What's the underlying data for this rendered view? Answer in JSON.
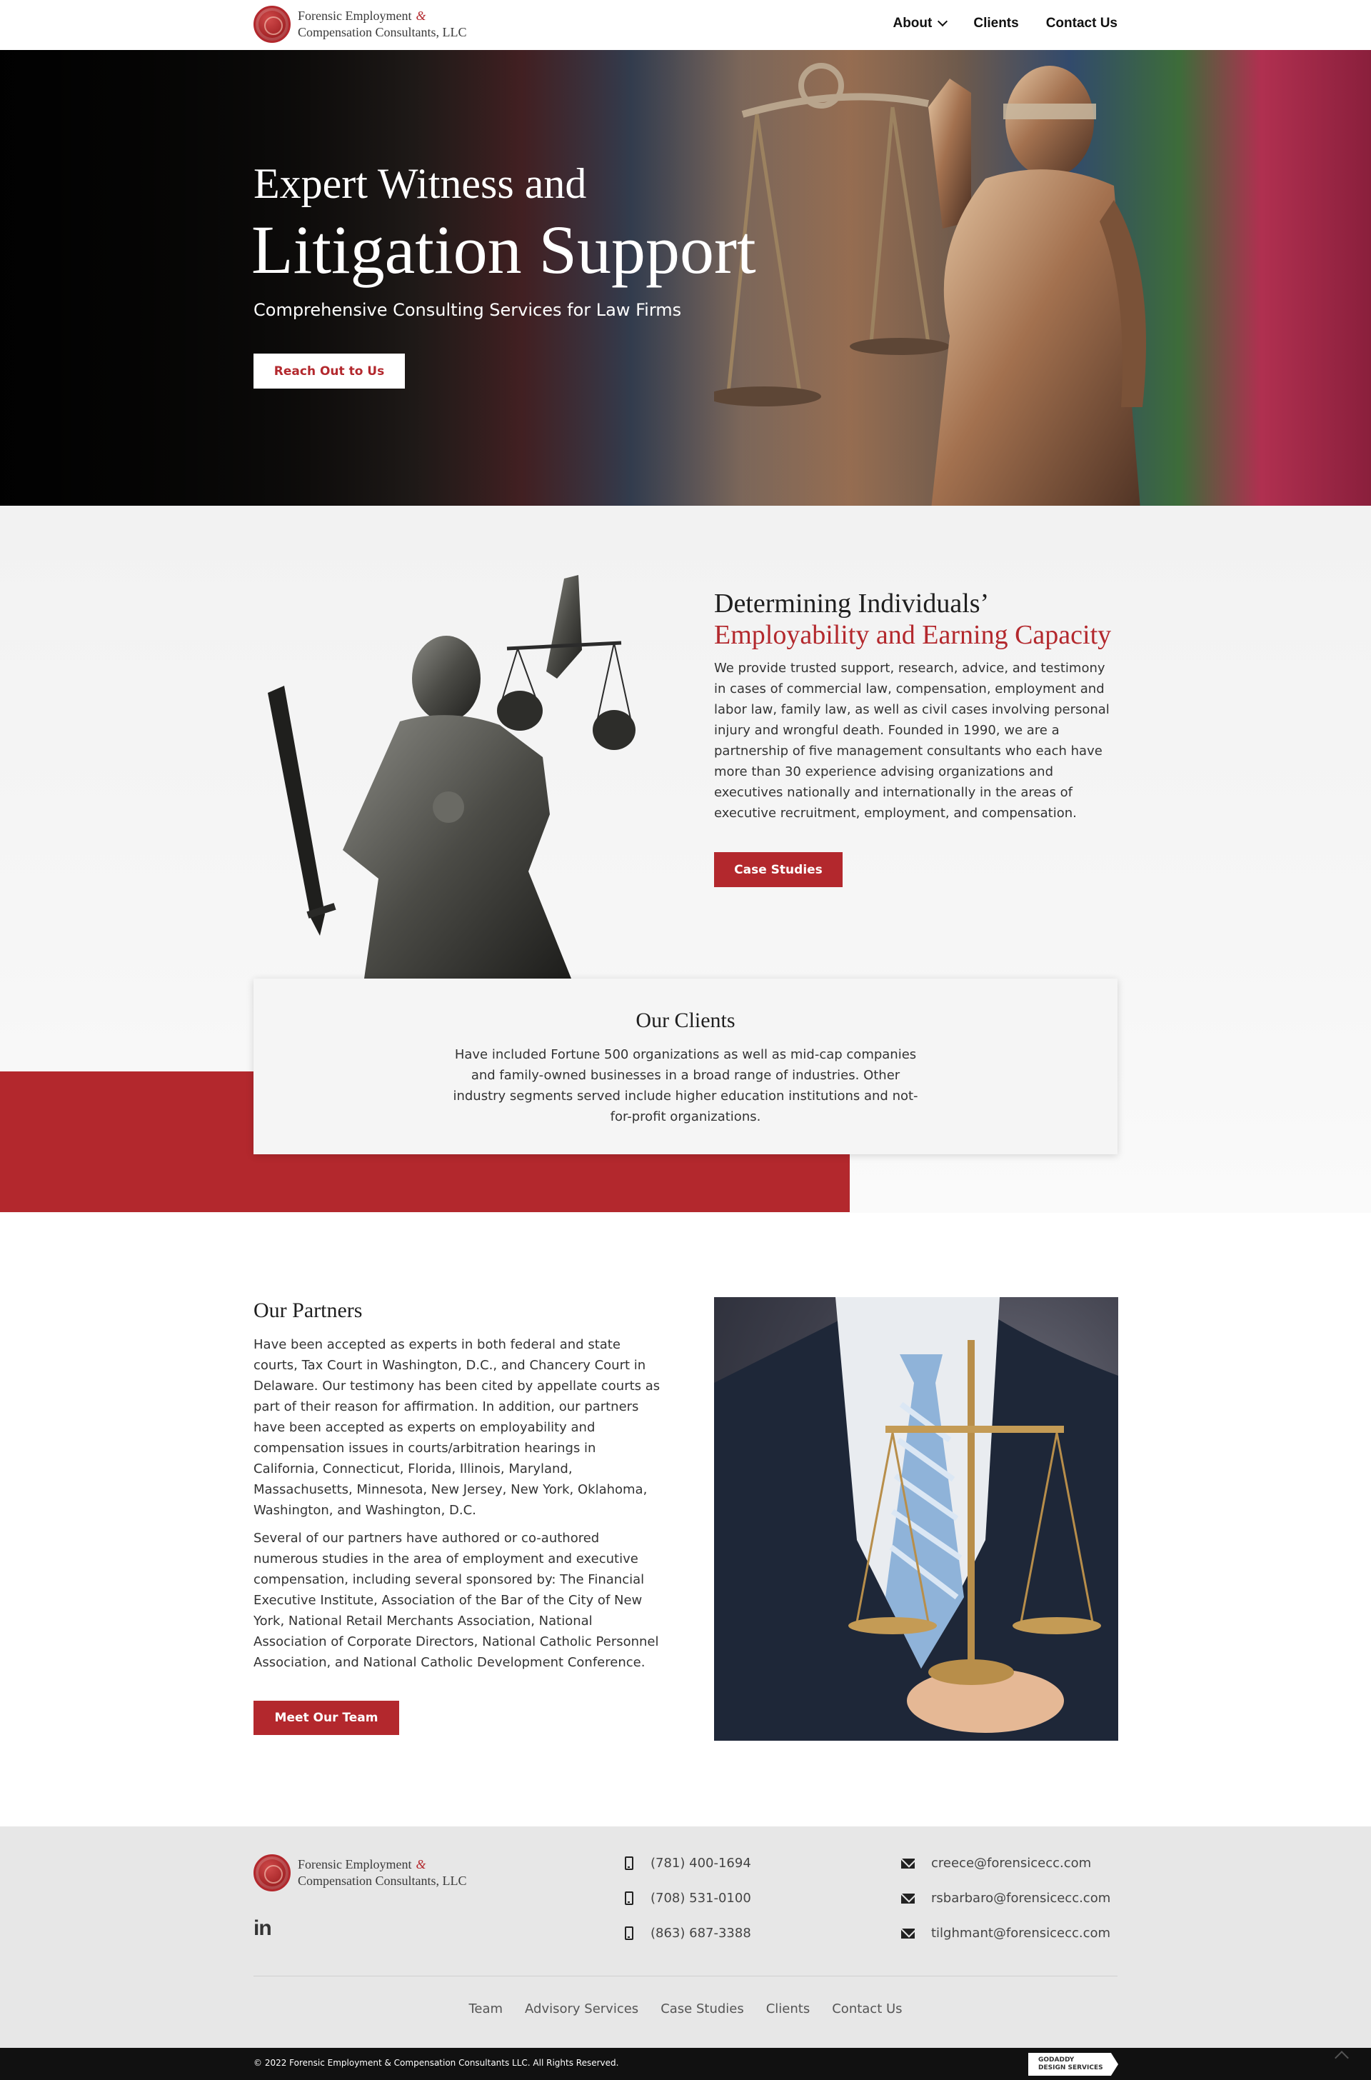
{
  "header": {
    "logo_line1": "Forensic Employment",
    "logo_amp": "&",
    "logo_line2": "Compensation Consultants, LLC",
    "nav": {
      "about": "About",
      "clients": "Clients",
      "contact": "Contact Us"
    }
  },
  "hero": {
    "pretitle": "Expert Witness and",
    "title": "Litigation Support",
    "subtitle": "Comprehensive Consulting Services for Law Firms",
    "cta": "Reach Out to Us"
  },
  "about": {
    "heading_line1": "Determining Individuals’",
    "heading_line2": "Employability and Earning Capacity",
    "body": "We provide trusted support, research, advice, and testimony in cases of commercial law, compensation, employment and labor law, family law, as well as civil cases involving personal injury and wrongful death. Founded in 1990, we are a partnership of five management consultants who each have more than 30 experience advising organizations and executives nationally and internationally in the areas of executive recruitment, employment, and compensation.",
    "cta": "Case Studies"
  },
  "clients": {
    "title": "Our Clients",
    "body": "Have included Fortune 500 organizations as well as mid-cap companies and family-owned businesses in a broad range of industries. Other industry segments served include higher education institutions and not-for-profit organizations."
  },
  "partners": {
    "title": "Our Partners",
    "p1": "Have been accepted as experts in both federal and state courts, Tax Court in Washington, D.C., and Chancery Court in Delaware. Our testimony has been cited by appellate courts as part of their reason for affirmation. In addition, our partners have been accepted as experts on employability and compensation issues in courts/arbitration hearings in California, Connecticut, Florida, Illinois, Maryland, Massachusetts, Minnesota, New Jersey, New York, Oklahoma, Washington, and Washington, D.C.",
    "p2": "Several of our partners have authored or co-authored numerous studies in the area of employment and executive compensation, including several sponsored by: The Financial Executive Institute, Association of the Bar of the City of New York, National Retail Merchants Association, National Association of Corporate Directors, National Catholic Personnel Association, and National Catholic Development Conference.",
    "cta": "Meet Our Team"
  },
  "footer": {
    "linkedin": "in",
    "phones": [
      "(781) 400-1694",
      "(708) 531-0100",
      "(863) 687-3388"
    ],
    "emails": [
      "creece@forensicecc.com",
      "rsbarbaro@forensicecc.com",
      "tilghmant@forensicecc.com"
    ],
    "links": [
      "Team",
      "Advisory Services",
      "Case Studies",
      "Clients",
      "Contact Us"
    ],
    "copyright": "© 2022 Forensic Employment & Compensation Consultants LLC. All Rights Reserved.",
    "badge_line1": "GODADDY",
    "badge_line2": "DESIGN SERVICES"
  },
  "colors": {
    "accent": "#b3282d",
    "footer_bg": "#e7e7e7",
    "bottom_bar": "#111111"
  }
}
